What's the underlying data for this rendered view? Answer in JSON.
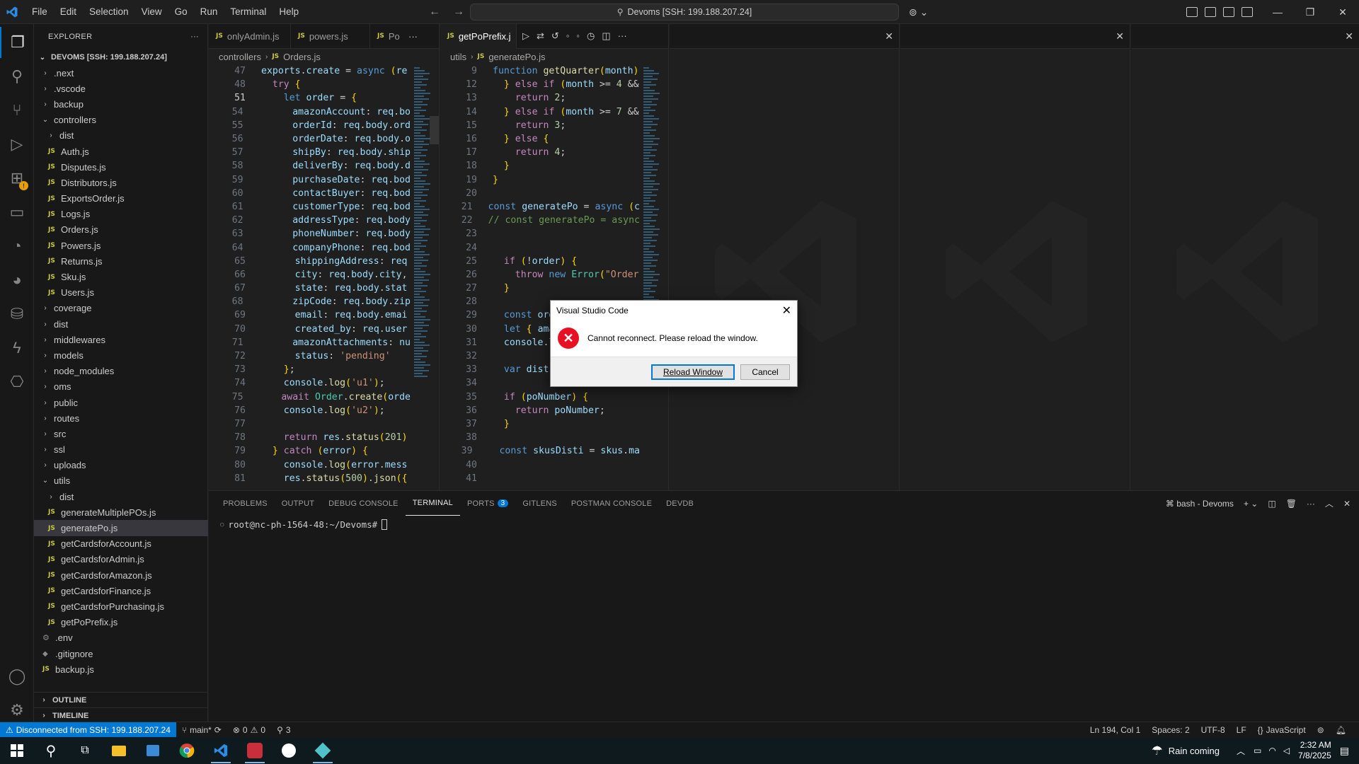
{
  "titlebar": {
    "menu": [
      "File",
      "Edit",
      "Selection",
      "View",
      "Go",
      "Run",
      "Terminal",
      "Help"
    ],
    "search_text": "Devoms [SSH: 199.188.207.24]"
  },
  "sidebar": {
    "title": "EXPLORER",
    "workspace": "DEVOMS [SSH: 199.188.207.24]",
    "items": [
      {
        "label": ".next",
        "type": "folder",
        "depth": 1,
        "open": false
      },
      {
        "label": ".vscode",
        "type": "folder",
        "depth": 1,
        "open": false
      },
      {
        "label": "backup",
        "type": "folder",
        "depth": 1,
        "open": false
      },
      {
        "label": "controllers",
        "type": "folder",
        "depth": 1,
        "open": true
      },
      {
        "label": "dist",
        "type": "folder",
        "depth": 2,
        "open": false
      },
      {
        "label": "Auth.js",
        "type": "js",
        "depth": 2
      },
      {
        "label": "Disputes.js",
        "type": "js",
        "depth": 2
      },
      {
        "label": "Distributors.js",
        "type": "js",
        "depth": 2
      },
      {
        "label": "ExportsOrder.js",
        "type": "js",
        "depth": 2
      },
      {
        "label": "Logs.js",
        "type": "js",
        "depth": 2
      },
      {
        "label": "Orders.js",
        "type": "js",
        "depth": 2
      },
      {
        "label": "Powers.js",
        "type": "js",
        "depth": 2
      },
      {
        "label": "Returns.js",
        "type": "js",
        "depth": 2
      },
      {
        "label": "Sku.js",
        "type": "js",
        "depth": 2
      },
      {
        "label": "Users.js",
        "type": "js",
        "depth": 2
      },
      {
        "label": "coverage",
        "type": "folder",
        "depth": 1,
        "open": false
      },
      {
        "label": "dist",
        "type": "folder",
        "depth": 1,
        "open": false
      },
      {
        "label": "middlewares",
        "type": "folder",
        "depth": 1,
        "open": false
      },
      {
        "label": "models",
        "type": "folder",
        "depth": 1,
        "open": false
      },
      {
        "label": "node_modules",
        "type": "folder",
        "depth": 1,
        "open": false
      },
      {
        "label": "oms",
        "type": "folder",
        "depth": 1,
        "open": false
      },
      {
        "label": "public",
        "type": "folder",
        "depth": 1,
        "open": false
      },
      {
        "label": "routes",
        "type": "folder",
        "depth": 1,
        "open": false
      },
      {
        "label": "src",
        "type": "folder",
        "depth": 1,
        "open": false
      },
      {
        "label": "ssl",
        "type": "folder",
        "depth": 1,
        "open": false
      },
      {
        "label": "uploads",
        "type": "folder",
        "depth": 1,
        "open": false
      },
      {
        "label": "utils",
        "type": "folder",
        "depth": 1,
        "open": true
      },
      {
        "label": "dist",
        "type": "folder",
        "depth": 2,
        "open": false
      },
      {
        "label": "generateMultiplePOs.js",
        "type": "js",
        "depth": 2
      },
      {
        "label": "generatePo.js",
        "type": "js",
        "depth": 2,
        "selected": true
      },
      {
        "label": "getCardsforAccount.js",
        "type": "js",
        "depth": 2
      },
      {
        "label": "getCardsforAdmin.js",
        "type": "js",
        "depth": 2
      },
      {
        "label": "getCardsforAmazon.js",
        "type": "js",
        "depth": 2
      },
      {
        "label": "getCardsforFinance.js",
        "type": "js",
        "depth": 2
      },
      {
        "label": "getCardsforPurchasing.js",
        "type": "js",
        "depth": 2
      },
      {
        "label": "getPoPrefix.js",
        "type": "js",
        "depth": 2
      },
      {
        "label": ".env",
        "type": "gear",
        "depth": 1
      },
      {
        "label": ".gitignore",
        "type": "diamond",
        "depth": 1
      },
      {
        "label": "backup.js",
        "type": "js",
        "depth": 1
      }
    ],
    "outline": "OUTLINE",
    "timeline": "TIMELINE"
  },
  "group1": {
    "tabs": [
      "onlyAdmin.js",
      "powers.js",
      "Po"
    ],
    "breadcrumb": [
      "controllers",
      "Orders.js"
    ],
    "lines": [
      {
        "n": "47",
        "t": "exports.create = async (re"
      },
      {
        "n": "48",
        "t": "  try {"
      },
      {
        "n": "51",
        "t": "    let order = {"
      },
      {
        "n": "54",
        "t": "      amazonAccount: req.bo"
      },
      {
        "n": "55",
        "t": "      orderId: req.body.ord"
      },
      {
        "n": "56",
        "t": "      orderDate: req.body.o"
      },
      {
        "n": "57",
        "t": "      shipBy: req.body.ship"
      },
      {
        "n": "58",
        "t": "      deliverBy: req.body.d"
      },
      {
        "n": "59",
        "t": "      purchaseDate: req.bod"
      },
      {
        "n": "60",
        "t": "      contactBuyer: req.bod"
      },
      {
        "n": "61",
        "t": "      customerType: req.bod"
      },
      {
        "n": "62",
        "t": "      addressType: req.body"
      },
      {
        "n": "63",
        "t": "      phoneNumber: req.body"
      },
      {
        "n": "64",
        "t": "      companyPhone: req.bod"
      },
      {
        "n": "65",
        "t": "      shippingAddress: req"
      },
      {
        "n": "66",
        "t": "      city: req.body.city,"
      },
      {
        "n": "67",
        "t": "      state: req.body.stat"
      },
      {
        "n": "68",
        "t": "      zipCode: req.body.zip"
      },
      {
        "n": "69",
        "t": "      email: req.body.emai"
      },
      {
        "n": "70",
        "t": "      created_by: req.user"
      },
      {
        "n": "71",
        "t": "      amazonAttachments: nu"
      },
      {
        "n": "72",
        "t": "      status: 'pending'"
      },
      {
        "n": "73",
        "t": "    };"
      },
      {
        "n": "74",
        "t": "    console.log('u1');"
      },
      {
        "n": "75",
        "t": "    await Order.create(orde"
      },
      {
        "n": "76",
        "t": "    console.log('u2');"
      },
      {
        "n": "77",
        "t": ""
      },
      {
        "n": "78",
        "t": "    return res.status(201)"
      },
      {
        "n": "79",
        "t": "  } catch (error) {"
      },
      {
        "n": "80",
        "t": "    console.log(error.mess"
      },
      {
        "n": "81",
        "t": "    res.status(500).json({"
      }
    ]
  },
  "group2": {
    "tabs": [
      "getPoPrefix.j"
    ],
    "breadcrumb": [
      "utils",
      "generatePo.js"
    ],
    "lines": [
      {
        "n": "9",
        "t": "function getQuarter(month)"
      },
      {
        "n": "12",
        "t": "  } else if (month >= 4 &&"
      },
      {
        "n": "13",
        "t": "    return 2;"
      },
      {
        "n": "14",
        "t": "  } else if (month >= 7 &&"
      },
      {
        "n": "15",
        "t": "    return 3;"
      },
      {
        "n": "16",
        "t": "  } else {"
      },
      {
        "n": "17",
        "t": "    return 4;"
      },
      {
        "n": "18",
        "t": "  }"
      },
      {
        "n": "19",
        "t": "}"
      },
      {
        "n": "20",
        "t": ""
      },
      {
        "n": "21",
        "t": "const generatePo = async (c"
      },
      {
        "n": "22",
        "t": "// const generatePo = async"
      },
      {
        "n": "23",
        "t": ""
      },
      {
        "n": "24",
        "t": ""
      },
      {
        "n": "25",
        "t": "  if (!order) {"
      },
      {
        "n": "26",
        "t": "    throw new Error(\"Order"
      },
      {
        "n": "27",
        "t": "  }"
      },
      {
        "n": "28",
        "t": ""
      },
      {
        "n": "29",
        "t": "  const ord"
      },
      {
        "n": "30",
        "t": "  let { ama"
      },
      {
        "n": "31",
        "t": "  console.lo"
      },
      {
        "n": "32",
        "t": ""
      },
      {
        "n": "33",
        "t": "  var distr"
      },
      {
        "n": "34",
        "t": ""
      },
      {
        "n": "35",
        "t": "  if (poNumber) {"
      },
      {
        "n": "36",
        "t": "    return poNumber;"
      },
      {
        "n": "37",
        "t": "  }"
      },
      {
        "n": "38",
        "t": ""
      },
      {
        "n": "39",
        "t": "  const skusDisti = skus.ma"
      },
      {
        "n": "40",
        "t": ""
      },
      {
        "n": "41",
        "t": ""
      }
    ]
  },
  "panel": {
    "tabs": [
      "PROBLEMS",
      "OUTPUT",
      "DEBUG CONSOLE",
      "TERMINAL",
      "PORTS",
      "GITLENS",
      "POSTMAN CONSOLE",
      "DEVDB"
    ],
    "active_tab": "TERMINAL",
    "ports_badge": "3",
    "terminal_name": "bash - Devoms",
    "prompt": "root@nc-ph-1564-48:~/Devoms#"
  },
  "statusbar": {
    "remote": "Disconnected from SSH: 199.188.207.24",
    "branch": "main*",
    "errors": "0",
    "warnings": "0",
    "ports": "3",
    "position": "Ln 194, Col 1",
    "spaces": "Spaces: 2",
    "encoding": "UTF-8",
    "eol": "LF",
    "language": "JavaScript"
  },
  "dialog": {
    "title": "Visual Studio Code",
    "message": "Cannot reconnect. Please reload the window.",
    "primary": "Reload Window",
    "secondary": "Cancel"
  },
  "taskbar": {
    "weather": "Rain coming",
    "time": "2:32 AM",
    "date": "7/8/2025"
  },
  "colors": {
    "accent": "#0078d4",
    "error": "#e81123",
    "js_icon": "#cbcb41"
  }
}
